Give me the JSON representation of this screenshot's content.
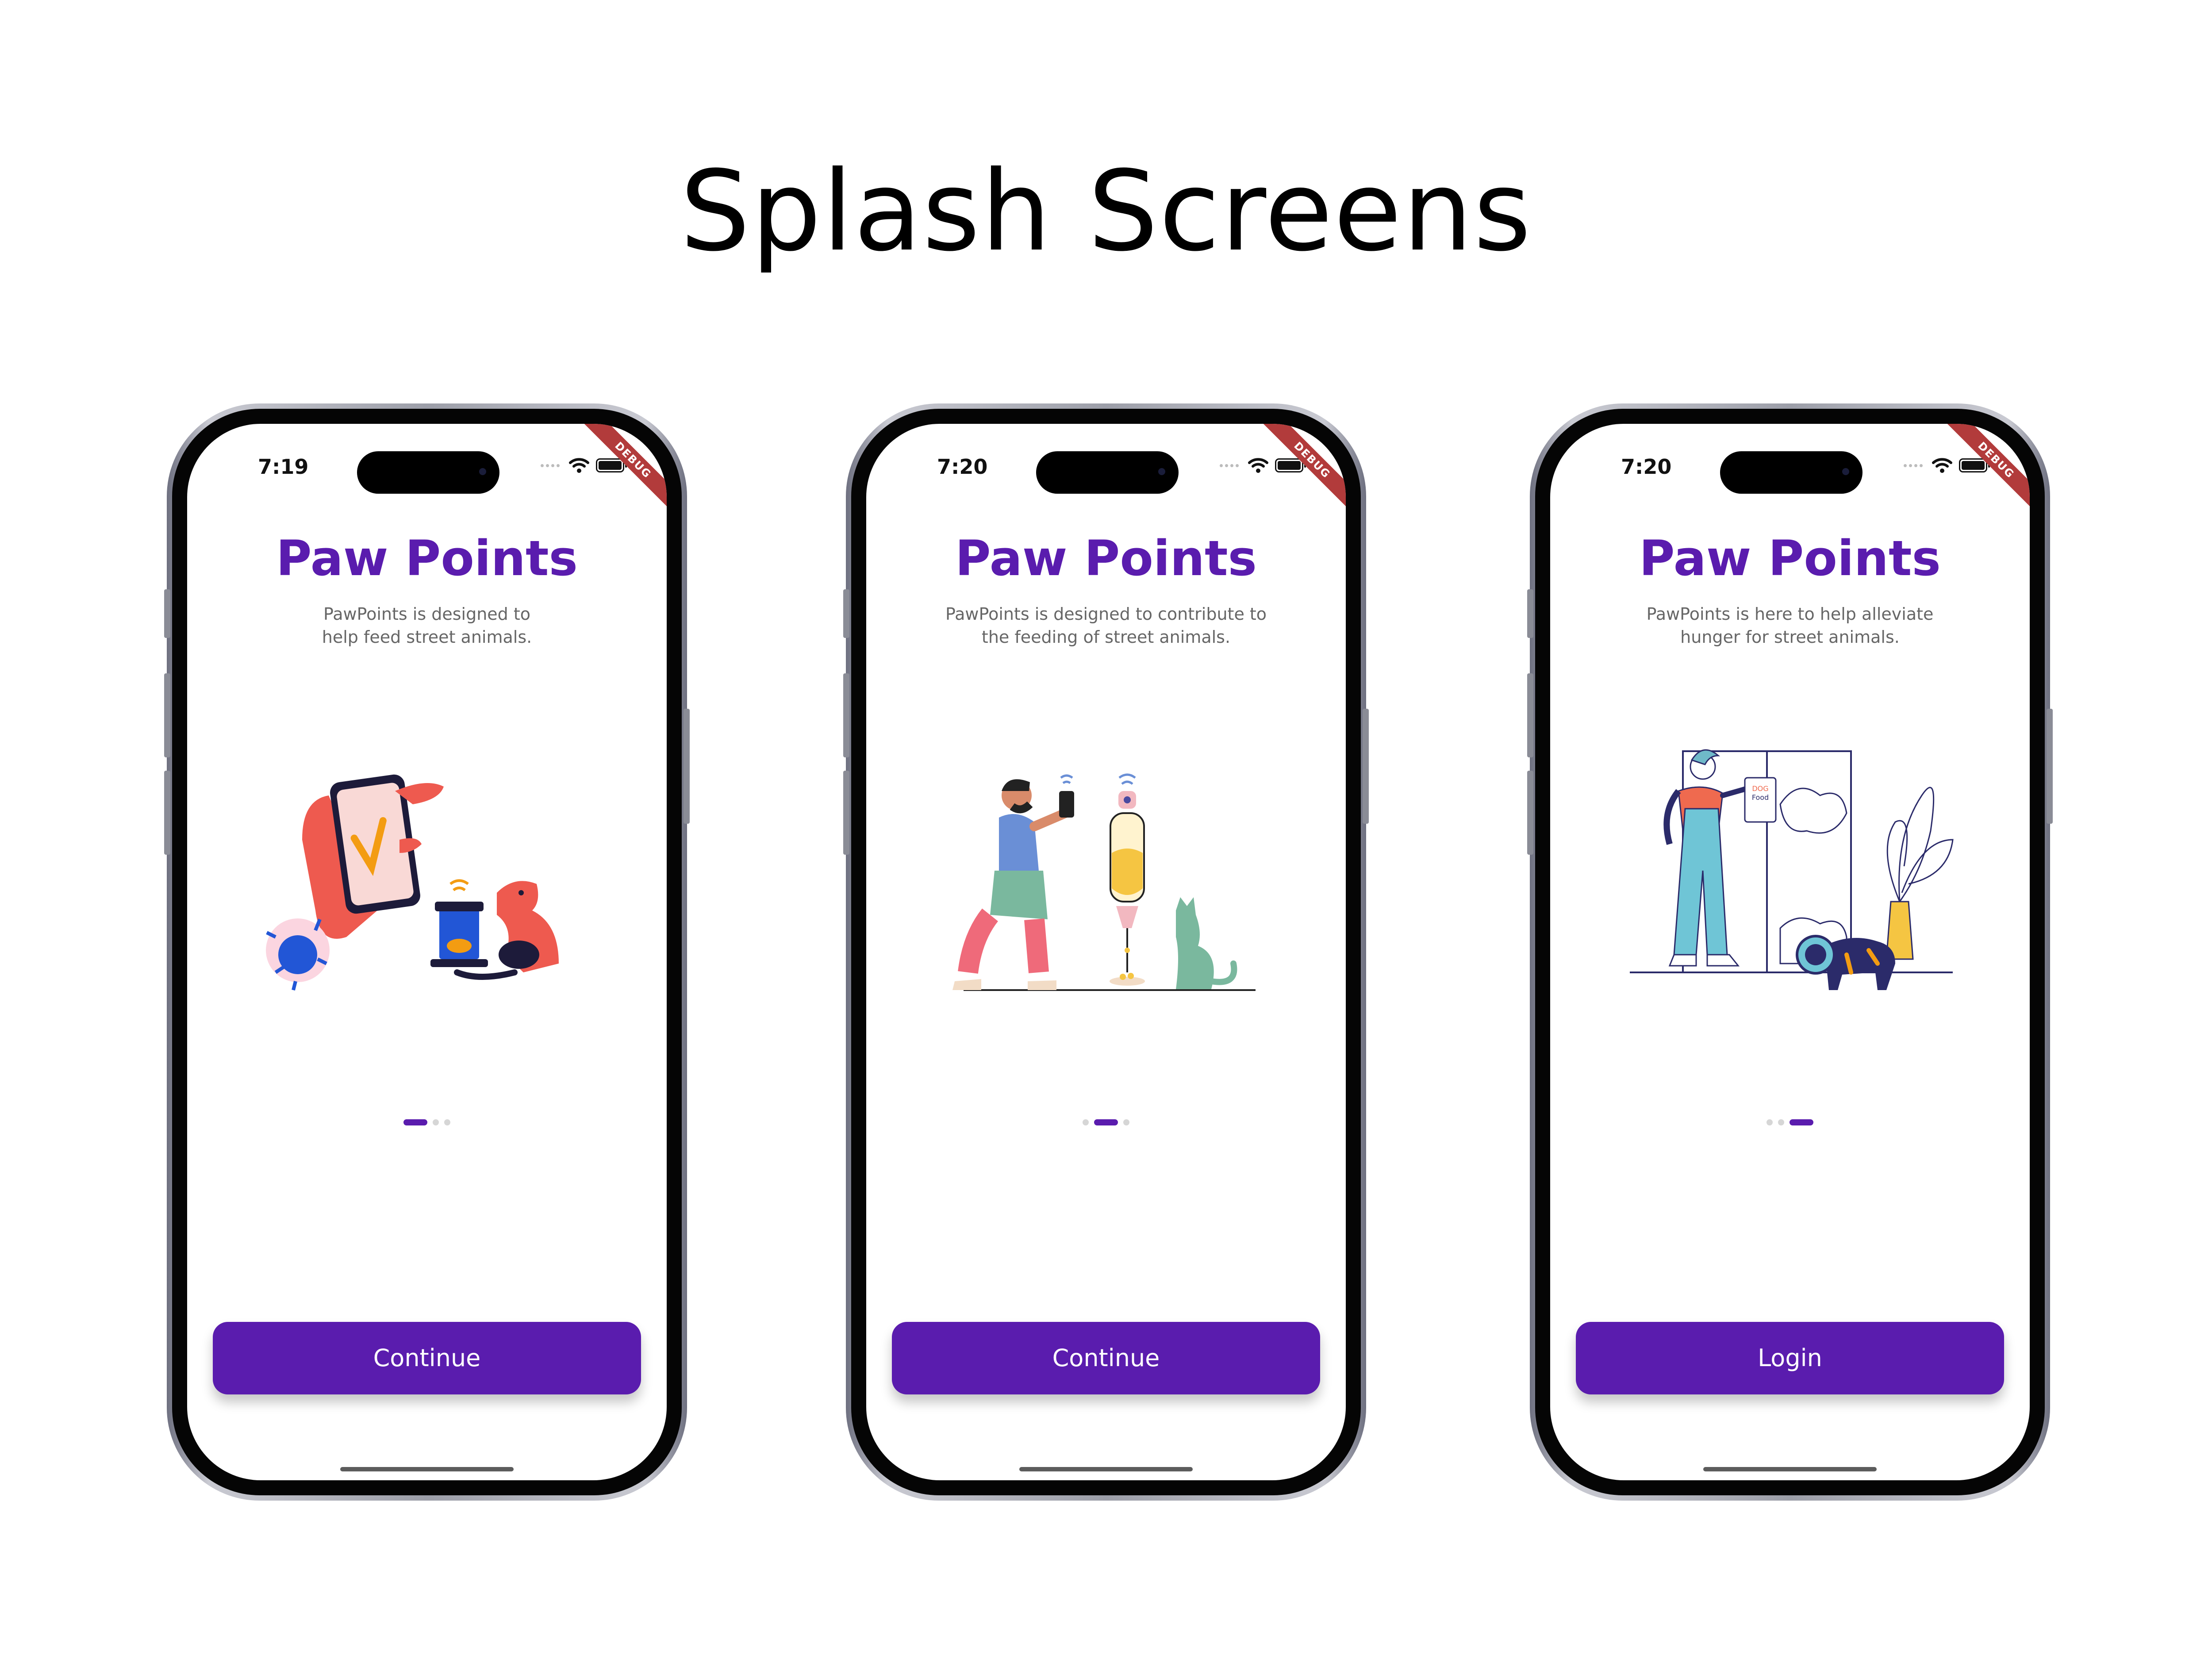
{
  "page": {
    "title": "Splash Screens"
  },
  "colors": {
    "brand": "#5a1cae",
    "ribbon": "#b23b3b"
  },
  "screens": [
    {
      "time": "7:19",
      "debug": "DEBUG",
      "app_title": "Paw Points",
      "subtitle_line1": "PawPoints is designed to",
      "subtitle_line2": "help feed street animals.",
      "illustration": "hand-phone-dog-feeder-illustration",
      "page_index": 1,
      "page_count": 3,
      "button_label": "Continue"
    },
    {
      "time": "7:20",
      "debug": "DEBUG",
      "app_title": "Paw Points",
      "subtitle_line1": "PawPoints is designed to contribute to",
      "subtitle_line2": "the feeding of street animals.",
      "illustration": "man-phone-cat-feeder-illustration",
      "page_index": 2,
      "page_count": 3,
      "button_label": "Continue"
    },
    {
      "time": "7:20",
      "debug": "DEBUG",
      "app_title": "Paw Points",
      "subtitle_line1": "PawPoints is here to help alleviate",
      "subtitle_line2": "hunger for street animals.",
      "illustration": "woman-dog-food-illustration",
      "illustration_text_1": "DOG",
      "illustration_text_2": "Food",
      "page_index": 3,
      "page_count": 3,
      "button_label": "Login"
    }
  ]
}
